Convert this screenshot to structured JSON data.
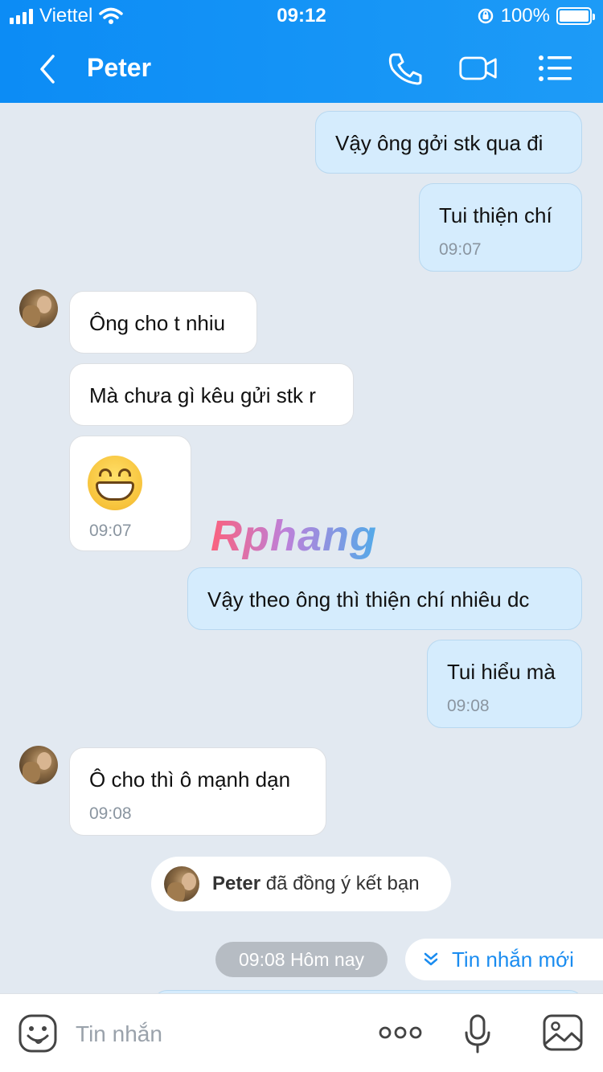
{
  "status_bar": {
    "carrier": "Viettel",
    "time": "09:12",
    "battery": "100%"
  },
  "header": {
    "title": "Peter",
    "icons": [
      "back-chevron-icon",
      "phone-icon",
      "video-camera-icon",
      "list-menu-icon"
    ]
  },
  "messages": [
    {
      "sender": "me",
      "text": "Vậy ông gởi stk qua đi"
    },
    {
      "sender": "me",
      "text": "Tui thiện chí",
      "time": "09:07"
    },
    {
      "sender": "them",
      "text": "Ông cho t nhiu"
    },
    {
      "sender": "them",
      "text": "Mà chưa gì kêu gửi stk r"
    },
    {
      "sender": "them",
      "emoji": "grinning-face-emoji",
      "time": "09:07"
    },
    {
      "sender": "me",
      "text": "Vậy theo ông thì thiện chí nhiêu dc"
    },
    {
      "sender": "me",
      "text": "Tui hiểu mà",
      "time": "09:08"
    },
    {
      "sender": "them",
      "text": "Ô cho thì ô mạnh dạn",
      "time": "09:08"
    }
  ],
  "watermark": "Rphang",
  "notice": {
    "name": "Peter",
    "text": "đã đồng ý kết bạn"
  },
  "time_divider": "09:08 Hôm nay",
  "new_messages_button": "Tin nhắn mới",
  "composer": {
    "placeholder": "Tin nhắn",
    "value": ""
  },
  "colors": {
    "header": "#0c8cf5",
    "my_bubble": "#d5ecfd",
    "their_bubble": "#ffffff",
    "background": "#e2e9f1",
    "accent": "#1a8cf0"
  }
}
